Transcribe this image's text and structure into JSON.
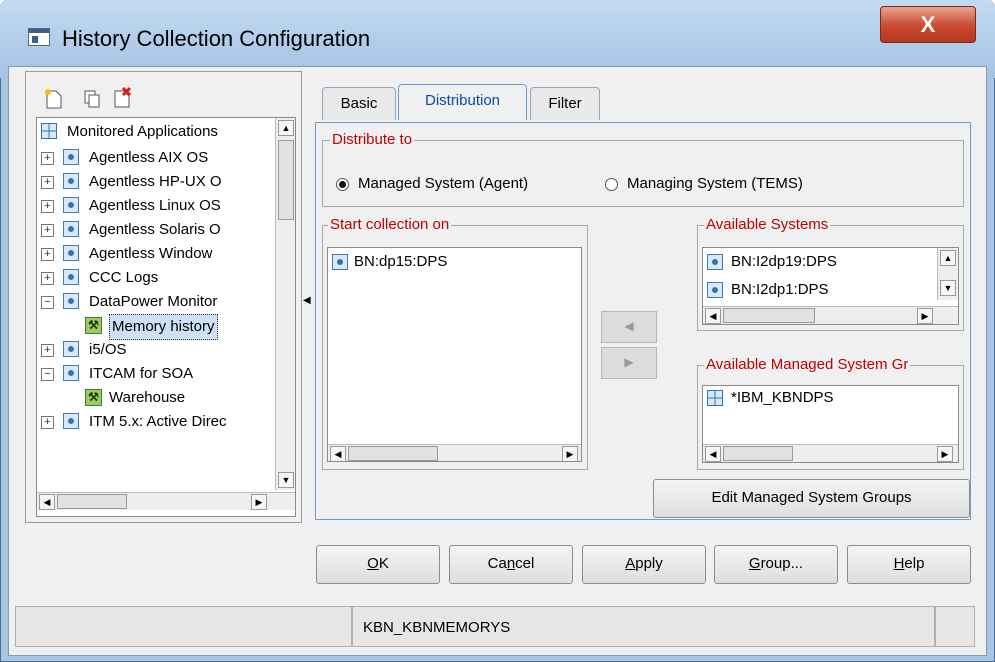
{
  "window": {
    "title": "History Collection Configuration",
    "close_label": "X"
  },
  "toolbar": {
    "icons": [
      "new-icon",
      "copy-icon",
      "delete-icon"
    ]
  },
  "tree": {
    "items": [
      {
        "label": "Monitored Applications",
        "kind": "root"
      },
      {
        "label": "Agentless AIX OS",
        "expander": "+"
      },
      {
        "label": "Agentless HP-UX O",
        "expander": "+"
      },
      {
        "label": "Agentless Linux OS",
        "expander": "+"
      },
      {
        "label": "Agentless Solaris O",
        "expander": "+"
      },
      {
        "label": "Agentless Window",
        "expander": "+"
      },
      {
        "label": "CCC Logs",
        "expander": "+"
      },
      {
        "label": "DataPower Monitor",
        "expander": "−"
      },
      {
        "label": "Memory history",
        "kind": "leaf",
        "selected": true
      },
      {
        "label": "i5/OS",
        "expander": "+"
      },
      {
        "label": "ITCAM for SOA",
        "expander": "−"
      },
      {
        "label": "Warehouse",
        "kind": "leaf"
      },
      {
        "label": "ITM 5.x: Active Direc",
        "expander": "+"
      }
    ]
  },
  "tabs": [
    {
      "label": "Basic",
      "active": false
    },
    {
      "label": "Distribution",
      "active": true
    },
    {
      "label": "Filter",
      "active": false
    }
  ],
  "distribute_to": {
    "legend": "Distribute to",
    "options": [
      {
        "label": "Managed System (Agent)",
        "checked": true
      },
      {
        "label": "Managing System (TEMS)",
        "checked": false
      }
    ]
  },
  "start_collection": {
    "legend": "Start collection on",
    "items": [
      "BN:dp15:DPS"
    ]
  },
  "available_systems": {
    "legend": "Available Systems",
    "items": [
      "BN:I2dp19:DPS",
      "BN:I2dp1:DPS"
    ]
  },
  "available_groups": {
    "legend": "Available Managed System Gr",
    "items": [
      "*IBM_KBNDPS"
    ]
  },
  "edit_groups_label": "Edit Managed System Groups",
  "buttons": {
    "ok": {
      "mnemonic": "O",
      "rest": "K"
    },
    "cancel": {
      "pre": "Ca",
      "mnemonic": "n",
      "rest": "cel"
    },
    "apply": {
      "mnemonic": "A",
      "rest": "pply"
    },
    "group": {
      "mnemonic": "G",
      "rest": "roup..."
    },
    "help": {
      "mnemonic": "H",
      "rest": "elp"
    }
  },
  "status": {
    "text": "KBN_KBNMEMORYS"
  },
  "colors": {
    "legend": "#c00000",
    "active_tab": "#0c4aa6",
    "selection": "#cde0f5"
  }
}
